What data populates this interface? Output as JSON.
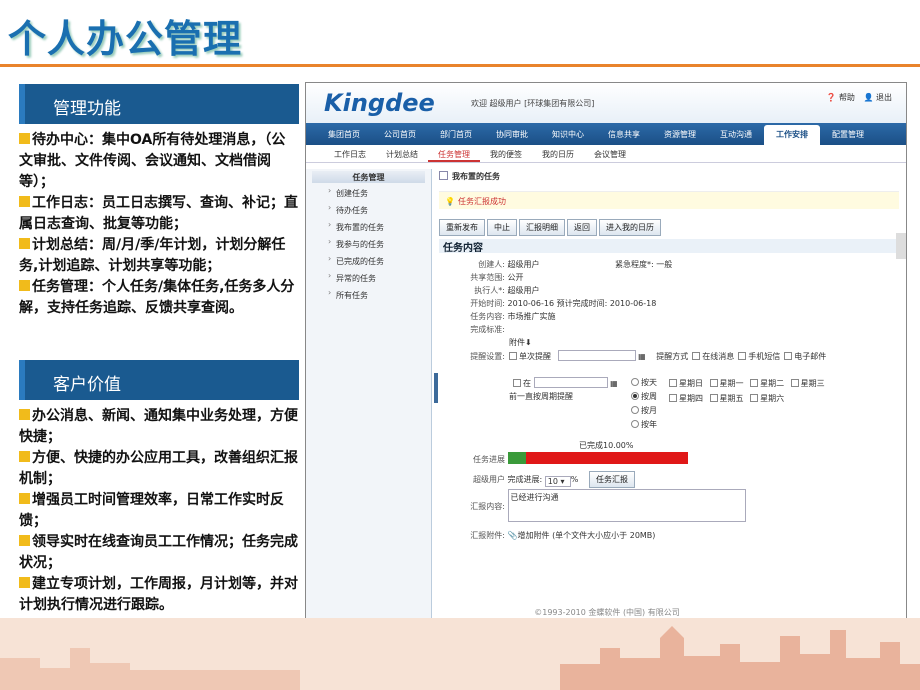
{
  "slide": {
    "title": "个人办公管理",
    "sections": [
      {
        "heading": "管理功能",
        "items": [
          "待办中心：集中OA所有待处理消息，（公文审批、文件传阅、会议通知、文档借阅等）；",
          "工作日志：员工日志撰写、查询、补记；直属日志查询、批复等功能；",
          "计划总结：周/月/季/年计划，计划分解任务,计划追踪、计划共享等功能；",
          "任务管理：个人任务/集体任务,任务多人分解，支持任务追踪、反馈共享查阅。"
        ]
      },
      {
        "heading": "客户价值",
        "items": [
          "办公消息、新闻、通知集中业务处理，方便快捷；",
          "方便、快捷的办公应用工具，改善组织汇报机制；",
          "增强员工时间管理效率，日常工作实时反馈；",
          "领导实时在线查询员工工作情况；任务完成状况；",
          "建立专项计划，工作周报，月计划等，并对计划执行情况进行跟踪。"
        ]
      }
    ]
  },
  "app": {
    "logo": "Kingdee",
    "welcome": "欢迎  超级用户 [环球集团有限公司]",
    "help": "帮助",
    "logout": "退出",
    "nav": [
      "集团首页",
      "公司首页",
      "部门首页",
      "协同审批",
      "知识中心",
      "信息共享",
      "资源管理",
      "互动沟通",
      "工作安排",
      "配置管理"
    ],
    "nav_active": "工作安排",
    "subnav": [
      "工作日志",
      "计划总结",
      "任务管理",
      "我的便签",
      "我的日历",
      "会议管理"
    ],
    "subnav_active": "任务管理",
    "sidebar": {
      "title": "任务管理",
      "items": [
        "创建任务",
        "待办任务",
        "我布置的任务",
        "我参与的任务",
        "已完成的任务",
        "异常的任务",
        "所有任务"
      ]
    },
    "breadcrumb": "我布置的任务",
    "notice": "任务汇报成功",
    "buttons": [
      "重新发布",
      "中止",
      "汇报明细",
      "返回",
      "进入我的日历"
    ],
    "content_heading": "任务内容",
    "fields": {
      "creator_label": "创建人:",
      "creator": "超级用户",
      "urgency_label": "紧急程度*:",
      "urgency": "一般",
      "scope_label": "共享范围:",
      "scope": "公开",
      "executor_label": "执行人*:",
      "executor": "超级用户",
      "start_label": "开始时间:",
      "start": "2010-06-16",
      "plan_end_label": "预计完成时间:",
      "plan_end": "2010-06-18",
      "content_label": "任务内容:",
      "content": "市场推广实施",
      "standard_label": "完成标准:",
      "attachment": "附件⬇",
      "reminder_label": "提醒设置:",
      "single_reminder": "单次提醒",
      "reminder_method": "提醒方式",
      "online_msg": "在线消息",
      "sms": "手机短信",
      "email": "电子邮件",
      "at": "在",
      "periodic_prefix": "前一直按周期提醒",
      "period_day": "按天",
      "period_week": "按周",
      "period_month": "按月",
      "period_year": "按年",
      "weekdays": [
        "星期日",
        "星期一",
        "星期二",
        "星期三",
        "星期四",
        "星期五",
        "星期六"
      ],
      "progress_caption": "已完成10.00%",
      "progress_label": "任务进展",
      "progress_value": 0.1,
      "reporter": "超级用户",
      "complete_label": "完成进展:",
      "complete_value": "10",
      "percent": "%",
      "report_btn": "任务汇报",
      "report_content_label": "汇报内容:",
      "report_content": "已经进行沟通",
      "report_attach_label": "汇报附件:",
      "add_attach": "增加附件",
      "attach_limit": "(单个文件大小应小于 20MB)"
    },
    "footer": "©1993-2010 金蝶软件 (中国) 有限公司"
  },
  "colors": {
    "title": "#1a6fb0",
    "section_header": "#1a5a90",
    "bullet": "#f1bb1b",
    "progress_done": "#3a9a3a",
    "progress_rest": "#e01818"
  }
}
